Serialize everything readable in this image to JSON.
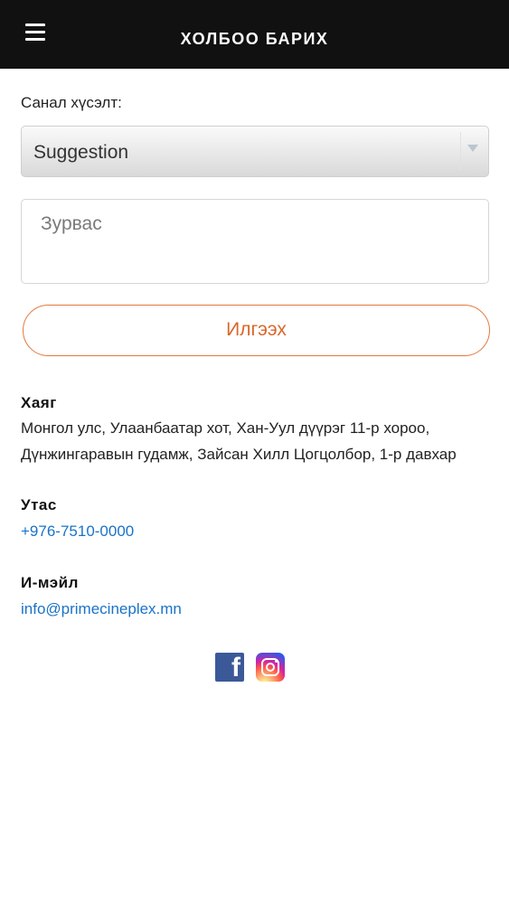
{
  "header": {
    "title": "ХОЛБОО БАРИХ",
    "menu_icon": "hamburger-menu-icon"
  },
  "form": {
    "type_label": "Санал хүсэлт:",
    "type_selected": "Suggestion",
    "message_placeholder": "Зурвас",
    "message_value": "",
    "submit_label": "Илгээх"
  },
  "contact": {
    "address_heading": "Хаяг",
    "address_line1": "Монгол улс, Улаанбаатар хот, Хан-Уул дүүрэг 11-р хороо,",
    "address_line2": "Дүнжингаравын гудамж, Зайсан Хилл Цогцолбор, 1-р давхар",
    "phone_heading": "Утас",
    "phone": "+976-7510-0000",
    "email_heading": "И-мэйл",
    "email": "info@primecineplex.mn"
  },
  "social": {
    "facebook_icon": "facebook-icon",
    "instagram_icon": "instagram-icon"
  },
  "colors": {
    "header_bg": "#111111",
    "accent_orange": "#e07a3c",
    "link_blue": "#1a73c8"
  }
}
